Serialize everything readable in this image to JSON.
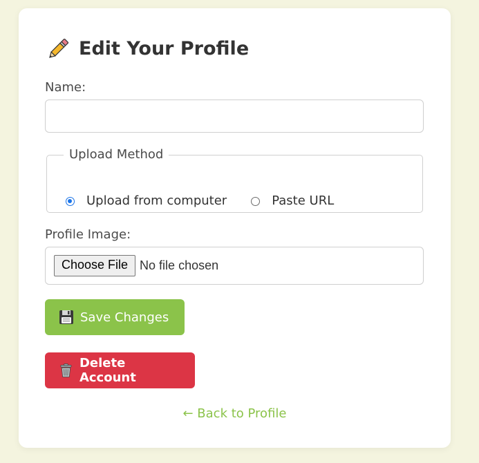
{
  "page": {
    "title": "Edit Your Profile",
    "title_icon": "pencil-icon"
  },
  "form": {
    "name_label": "Name:",
    "name_value": "",
    "upload_method": {
      "legend": "Upload Method",
      "options": [
        {
          "label": "Upload from computer",
          "checked": true
        },
        {
          "label": "Paste URL",
          "checked": false
        }
      ]
    },
    "image_label": "Profile Image:",
    "file_button_label": "Choose File",
    "file_status": "No file chosen",
    "save_label": "Save Changes",
    "save_icon": "floppy-disk-icon",
    "delete_label": "Delete Account",
    "delete_icon": "trash-icon",
    "back_link": "← Back to Profile"
  },
  "colors": {
    "page_background": "#f4f4df",
    "accent_green": "#8bc34a",
    "danger_red": "#dc3545",
    "radio_blue": "#1a73e8"
  }
}
